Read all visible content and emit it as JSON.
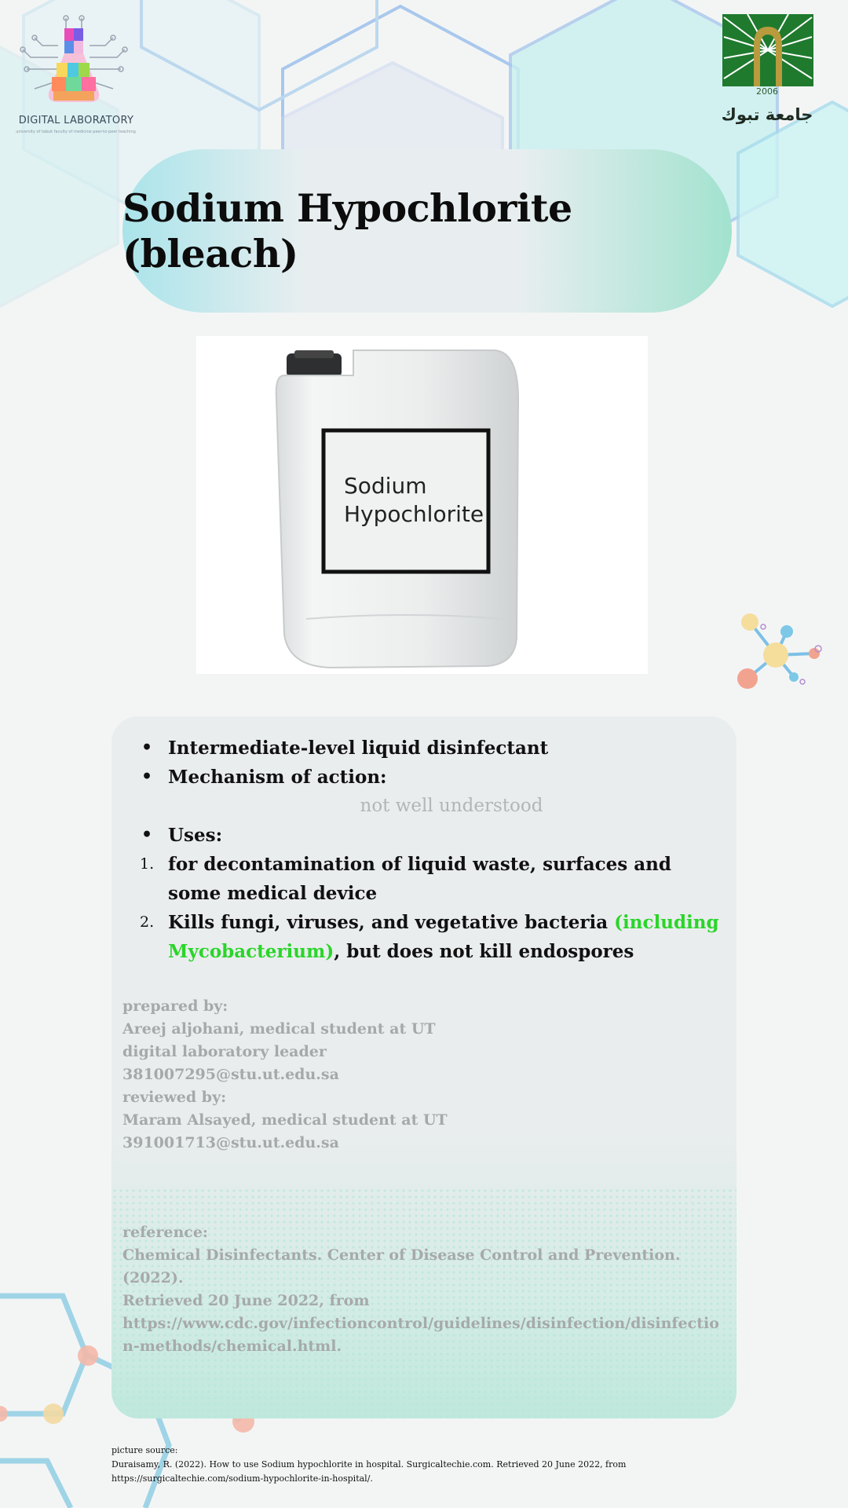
{
  "logos": {
    "left_label": "DIGITAL LABORATORY",
    "left_sub": "university of tabuk faculty of medicine peer-to-peer teaching",
    "right_year": "2006",
    "right_arabic": "جامعة تبوك"
  },
  "title": "Sodium Hypochlorite (bleach)",
  "product_image": {
    "label_line1": "Sodium",
    "label_line2": "Hypochlorite"
  },
  "info": {
    "bullet1": "Intermediate-level liquid disinfectant",
    "bullet2": "Mechanism of action:",
    "mechanism_note": "not well understood",
    "bullet3": "Uses:",
    "use1_num": "1.",
    "use1": "for decontamination of liquid waste, surfaces and some medical device",
    "use2_num": "2.",
    "use2_part1": "Kills fungi, viruses, and vegetative bacteria ",
    "use2_green": "(including Mycobacterium)",
    "use2_part2": ", but does not kill endospores"
  },
  "credits": {
    "prepared_label": "prepared by:",
    "prepared_name": "Areej aljohani, medical student at UT",
    "prepared_role": "digital laboratory leader",
    "prepared_email": "381007295@stu.ut.edu.sa",
    "reviewed_label": "reviewed by:",
    "reviewed_name": "Maram Alsayed, medical student at UT",
    "reviewed_email": "391001713@stu.ut.edu.sa"
  },
  "reference": {
    "label": "reference:",
    "line1": "Chemical Disinfectants. Center of Disease Control and Prevention. (2022).",
    "line2": "Retrieved 20 June 2022, from",
    "line3": "https://www.cdc.gov/infectioncontrol/guidelines/disinfection/disinfection-methods/chemical.html."
  },
  "picture_source": {
    "label": "picture source:",
    "text": "Duraisamy, R. (2022). How to use Sodium hypochlorite in hospital. Surgicaltechie.com. Retrieved 20 June 2022, from https://surgicaltechie.com/sodium-hypochlorite-in-hospital/."
  },
  "colors": {
    "accent_green": "#2ad52a",
    "muted_text": "#a6a9ab",
    "title_pill_left": "#a9e4ea",
    "title_pill_right": "#a2e2cf"
  }
}
